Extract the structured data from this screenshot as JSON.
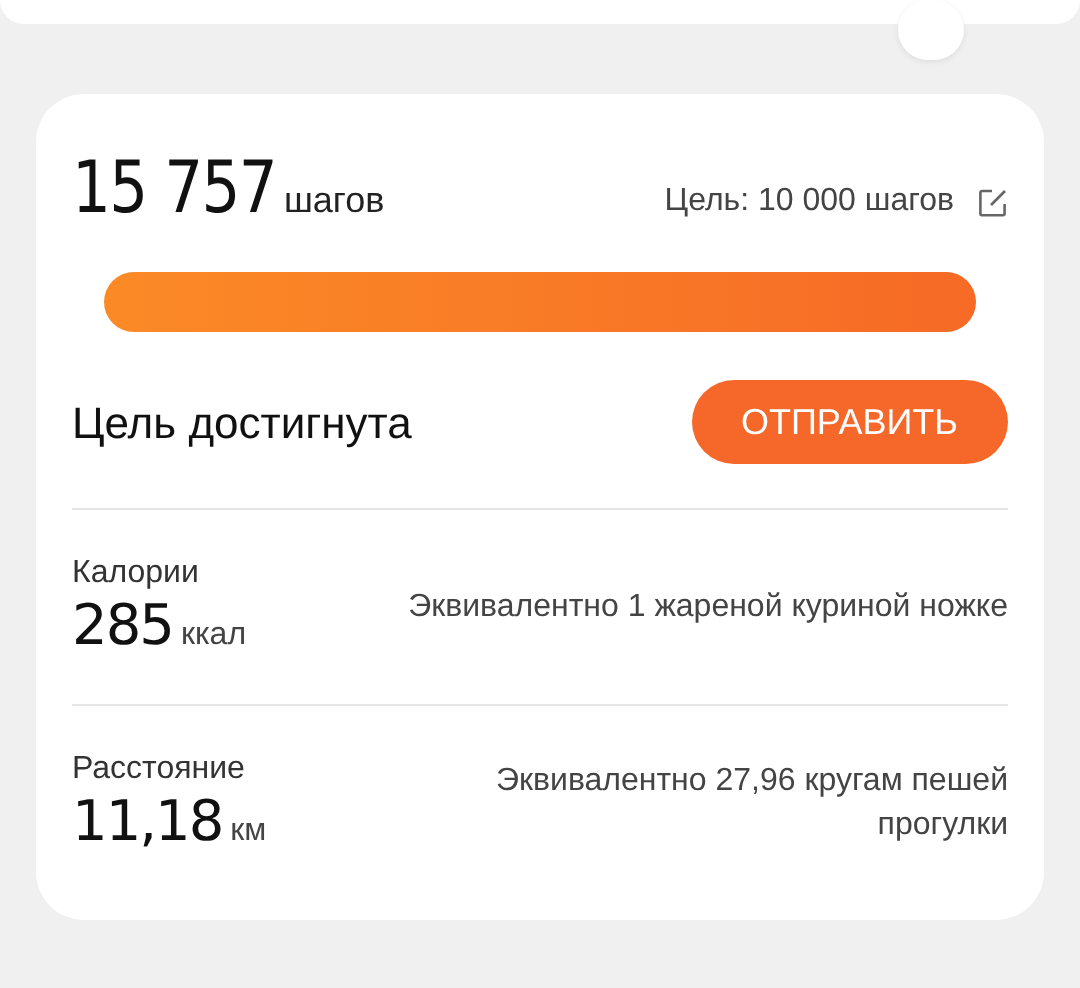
{
  "steps": {
    "value": "15 757",
    "unit": "шагов",
    "goal": "Цель: 10 000 шагов"
  },
  "goal_status": "Цель достигнута",
  "send_button": "ОТПРАВИТЬ",
  "stats": [
    {
      "label": "Калории",
      "value": "285",
      "unit": "ккал",
      "equivalent": "Эквивалентно 1 жареной куриной ножке"
    },
    {
      "label": "Расстояние",
      "value": "11,18",
      "unit": "км",
      "equivalent": "Эквивалентно 27,96 кругам пешей прогулки"
    }
  ]
}
